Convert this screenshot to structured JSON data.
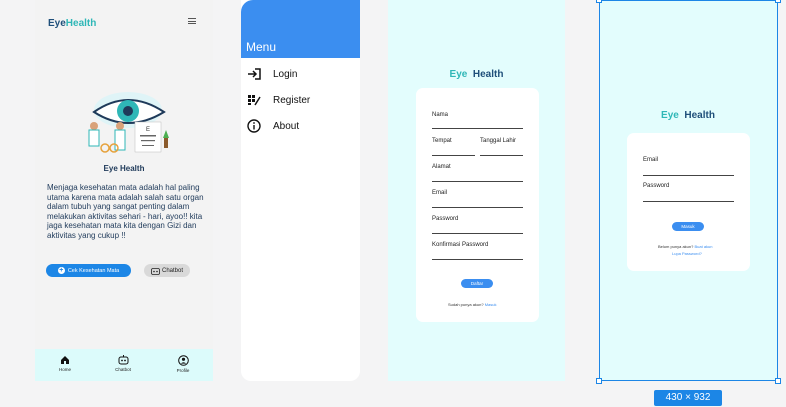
{
  "home": {
    "logo_eye": "Eye",
    "logo_health": "Health",
    "hero_title": "Eye Health",
    "description": "Menjaga kesehatan mata adalah hal paling utama karena mata adalah salah satu organ dalam tubuh yang sangat penting dalam melakukan aktivitas sehari - hari, ayoo!! kita jaga kesehatan mata kita dengan Gizi dan aktivitas yang cukup !!",
    "cek_button": "Cek Kesehatan Mata",
    "chatbot_button": "Chatbot",
    "nav": [
      {
        "label": "Home",
        "icon": "home-icon"
      },
      {
        "label": "Chatbot",
        "icon": "chatbot-icon"
      },
      {
        "label": "Profile",
        "icon": "profile-icon"
      }
    ]
  },
  "menu": {
    "title": "Menu",
    "items": [
      {
        "label": "Login",
        "icon": "login-icon"
      },
      {
        "label": "Register",
        "icon": "register-icon"
      },
      {
        "label": "About",
        "icon": "info-icon"
      }
    ]
  },
  "register": {
    "title_eye": "Eye",
    "title_health": "Health",
    "fields": {
      "nama": "Nama",
      "tempat": "Tempat",
      "tanggal_lahir": "Tanggal Lahir",
      "alamat": "Alamat",
      "email": "Email",
      "password": "Password",
      "konfirmasi": "Konfirmasi Password"
    },
    "button": "Daftar",
    "footer_text": "Sudah punya akun?",
    "footer_link": "Masuk"
  },
  "login": {
    "title_eye": "Eye",
    "title_health": "Health",
    "email_label": "Email",
    "password_label": "Password",
    "button": "Masuk",
    "no_account_text": "Belum punya akun?",
    "register_link": "Buat akun",
    "forgot_link": "Lupa Password?"
  },
  "frame_size_badge": "430 × 932",
  "colors": {
    "accent_blue": "#1c86e6",
    "teal": "#2fb7b7",
    "navy": "#1f4f7a",
    "light_cyan": "#e3fdfd"
  }
}
